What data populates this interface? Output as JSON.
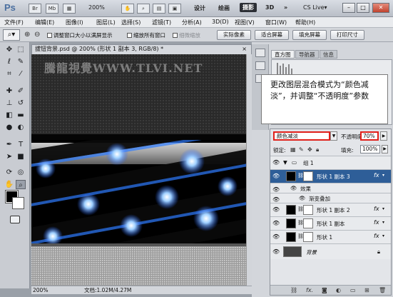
{
  "titlebar": {
    "logo": "Ps",
    "icons": [
      "Br",
      "Mb"
    ],
    "zoom": "200%",
    "workspaces": [
      "设计",
      "绘画",
      "摄影",
      "3D",
      "»"
    ],
    "active_workspace": "摄影",
    "cslive": "CS Live▾"
  },
  "menu": [
    "文件(F)",
    "编辑(E)",
    "图像(I)",
    "图层(L)",
    "选择(S)",
    "滤镜(T)",
    "分析(A)",
    "3D(D)",
    "视图(V)",
    "窗口(W)",
    "帮助(H)"
  ],
  "options": {
    "check_resize": "调整窗口大小以满屏显示",
    "check_zoom_all": "缩放所有窗口",
    "check_scrubby": "细微缩放",
    "btn_actual": "实际像素",
    "btn_fit": "适合屏幕",
    "btn_fill": "填充屏幕",
    "btn_print": "打印尺寸"
  },
  "document": {
    "tab_title": "拔钮背景.psd @ 200% (形状 1 副本 3, RGB/8) *",
    "tab_close": "×",
    "watermark": "騰龍視覺WWW.TLVI.NET",
    "status_zoom": "200%",
    "status_doc": "文档:1.02M/4.27M"
  },
  "panels": {
    "tabs": [
      "直方图",
      "导航器",
      "信息"
    ],
    "callout": "更改图层混合模式为“颜色减淡”，并调整“不透明度”参数"
  },
  "layers": {
    "blend_mode": "颜色减淡",
    "opacity_label": "不透明度:",
    "opacity": "70%",
    "lock_label": "锁定:",
    "fill_label": "填充:",
    "fill": "100%",
    "rows": [
      {
        "name": "组 1",
        "type": "group"
      },
      {
        "name": "形状 1 副本 3",
        "fx": "fx",
        "selected": true
      },
      {
        "name": "效果",
        "type": "effect"
      },
      {
        "name": "渐变叠加",
        "type": "effect-item"
      },
      {
        "name": "形状 1 副本 2",
        "fx": "fx"
      },
      {
        "name": "形状 1 副本",
        "fx": "fx"
      },
      {
        "name": "形状 1",
        "fx": "fx"
      },
      {
        "name": "背景",
        "type": "background"
      }
    ]
  },
  "colors": {
    "accent_red": "#e0201a",
    "selection_blue": "#2e5e98",
    "canvas_glow": "#2f7dff"
  }
}
